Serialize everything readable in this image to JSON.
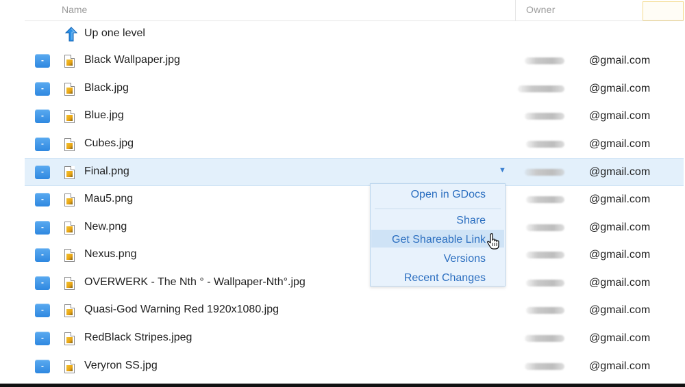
{
  "header": {
    "name_col": "Name",
    "owner_col": "Owner"
  },
  "up_row": {
    "label": "Up one level",
    "icon": "up-arrow-icon"
  },
  "files": [
    {
      "name": "Black Wallpaper.jpg",
      "owner": "@gmail.com"
    },
    {
      "name": "Black.jpg",
      "owner": "@gmail.com"
    },
    {
      "name": "Blue.jpg",
      "owner": "@gmail.com"
    },
    {
      "name": "Cubes.jpg",
      "owner": "@gmail.com"
    },
    {
      "name": "Final.png",
      "owner": "@gmail.com",
      "selected": true
    },
    {
      "name": "Mau5.png",
      "owner": "@gmail.com"
    },
    {
      "name": "New.png",
      "owner": "@gmail.com"
    },
    {
      "name": "Nexus.png",
      "owner": "@gmail.com"
    },
    {
      "name": "OVERWERK - The Nth ° - Wallpaper-Nth°.jpg",
      "owner": "@gmail.com"
    },
    {
      "name": "Quasi-God Warning Red 1920x1080.jpg",
      "owner": "@gmail.com"
    },
    {
      "name": "RedBlack Stripes.jpeg",
      "owner": "@gmail.com"
    },
    {
      "name": "Veryron SS.jpg",
      "owner": "@gmail.com"
    }
  ],
  "row_dropdown_glyph": "▼",
  "checkbox_glyph": "-",
  "context_menu": {
    "items": [
      "Open in GDocs",
      "Share",
      "Get Shareable Link",
      "Versions",
      "Recent Changes"
    ],
    "highlighted": "Get Shareable Link"
  },
  "colors": {
    "accent": "#2f88e0",
    "link": "#2c6fc0",
    "selected_row": "#e3f0fb"
  }
}
